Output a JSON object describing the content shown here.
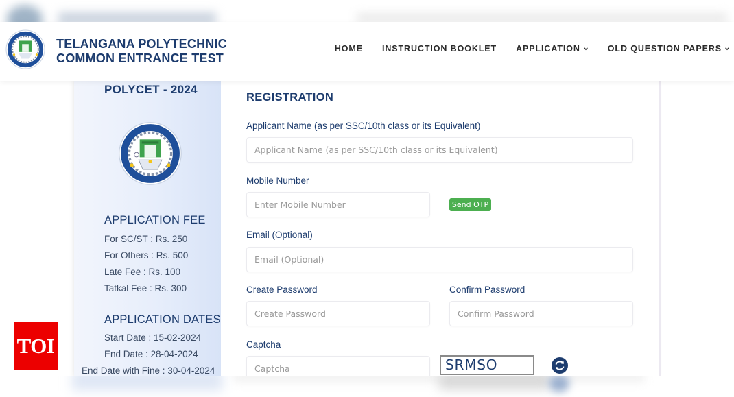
{
  "header": {
    "brand_line1": "TELANGANA POLYTECHNIC",
    "brand_line2": "COMMON ENTRANCE TEST",
    "logo_icon": "sbtet-emblem-icon",
    "nav": [
      {
        "label": "HOME",
        "has_dropdown": false
      },
      {
        "label": "INSTRUCTION BOOKLET",
        "has_dropdown": false
      },
      {
        "label": "APPLICATION",
        "has_dropdown": true
      },
      {
        "label": "OLD QUESTION PAPERS",
        "has_dropdown": true
      }
    ]
  },
  "sidebar": {
    "title": "POLYCET - 2024",
    "fee": {
      "heading": "APPLICATION FEE",
      "lines": [
        "For SC/ST : Rs. 250",
        "For Others : Rs. 500",
        "Late Fee : Rs. 100",
        "Tatkal Fee : Rs. 300"
      ]
    },
    "dates": {
      "heading": "APPLICATION DATES",
      "lines": [
        "Start Date : 15-02-2024",
        "End Date : 28-04-2024",
        "End Date with Fine : 30-04-2024"
      ]
    }
  },
  "form": {
    "title": "REGISTRATION",
    "applicant_name": {
      "label": "Applicant Name (as per SSC/10th class or its Equivalent)",
      "placeholder": "Applicant Name (as per SSC/10th class or its Equivalent)",
      "value": ""
    },
    "mobile": {
      "label": "Mobile Number",
      "placeholder": "Enter Mobile Number",
      "value": ""
    },
    "send_otp_label": "Send OTP",
    "email": {
      "label": "Email (Optional)",
      "placeholder": "Email (Optional)",
      "value": ""
    },
    "create_password": {
      "label": "Create Password",
      "placeholder": "Create Password",
      "value": ""
    },
    "confirm_password": {
      "label": "Confirm Password",
      "placeholder": "Confirm Password",
      "value": ""
    },
    "captcha": {
      "label": "Captcha",
      "placeholder": "Captcha",
      "value": "",
      "code": "SRMSO"
    }
  },
  "watermark": {
    "text": "TOI"
  },
  "colors": {
    "brand_navy": "#1d3c6e",
    "otp_green": "#4caf50",
    "toi_red": "#ec0000"
  }
}
